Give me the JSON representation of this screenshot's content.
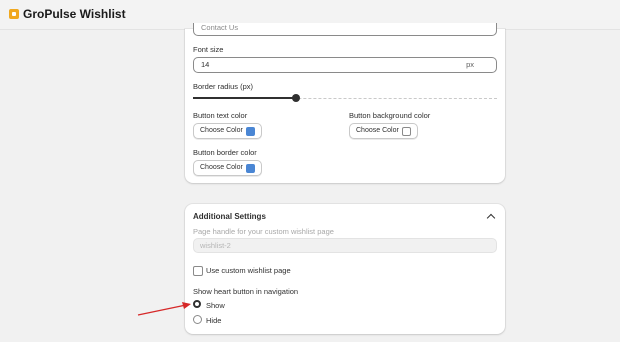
{
  "app": {
    "title": "GroPulse Wishlist",
    "logo_icon": "app-logo-icon"
  },
  "button_card": {
    "text_input_value": "Contact Us",
    "font_size_label": "Font size",
    "font_size_value": "14",
    "font_size_suffix": "px",
    "border_radius_label": "Border radius (px)",
    "border_radius_level": 0.34,
    "button_text_color_label": "Button text color",
    "button_text_color_button": "Choose Color",
    "button_text_color": "#4a86d4",
    "button_bg_color_label": "Button background color",
    "button_bg_color_button": "Choose Color",
    "button_bg_color": "#ffffff",
    "button_border_color_label": "Button border color",
    "button_border_color_button": "Choose Color",
    "button_border_color": "#4a86d4"
  },
  "additional_settings": {
    "title": "Additional Settings",
    "page_handle_label": "Page handle for your custom wishlist page",
    "page_handle_value": "wishlist-2",
    "custom_page_checkbox_label": "Use custom wishlist page",
    "custom_page_checked": false,
    "heart_nav_label": "Show heart button in navigation",
    "options": [
      {
        "label": "Show",
        "selected": true
      },
      {
        "label": "Hide",
        "selected": false
      }
    ]
  },
  "annotation": {
    "arrow_color": "#d62828"
  }
}
